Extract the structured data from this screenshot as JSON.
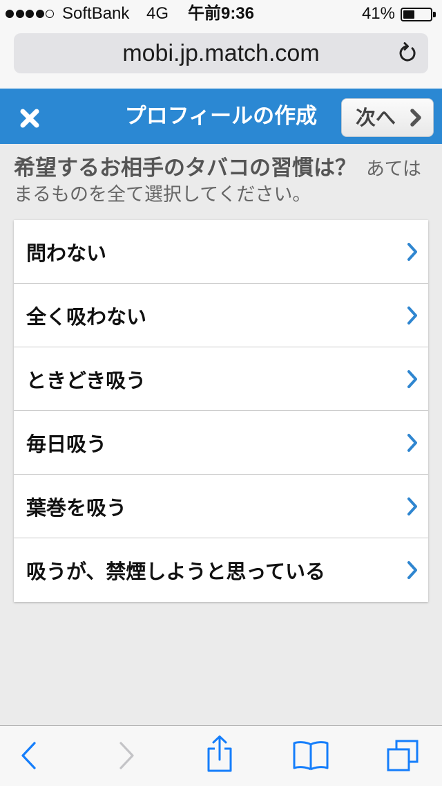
{
  "status_bar": {
    "signal": {
      "bars": 4,
      "max": 5
    },
    "carrier": "SoftBank",
    "network": "4G",
    "time": "午前9:36",
    "battery_text": "41%",
    "battery_level": 0.41
  },
  "address_bar": {
    "url": "mobi.jp.match.com",
    "reload_icon": "reload-icon"
  },
  "header": {
    "close_icon": "close-icon",
    "title": "プロフィールの作成",
    "next_label": "次へ",
    "next_icon": "chevron-right-icon"
  },
  "question": {
    "title": "希望するお相手のタバコの習慣は？",
    "hint": "あてはまるものを全て選択してください。"
  },
  "options": [
    {
      "label": "問わない",
      "icon": "chevron-right-icon"
    },
    {
      "label": "全く吸わない",
      "icon": "chevron-right-icon"
    },
    {
      "label": "ときどき吸う",
      "icon": "chevron-right-icon"
    },
    {
      "label": "毎日吸う",
      "icon": "chevron-right-icon"
    },
    {
      "label": "葉巻を吸う",
      "icon": "chevron-right-icon"
    },
    {
      "label": "吸うが、禁煙しようと思っている",
      "icon": "chevron-right-icon"
    }
  ],
  "toolbar": {
    "back_icon": "chevron-left-icon",
    "forward_icon": "chevron-right-icon",
    "forward_enabled": false,
    "share_icon": "share-icon",
    "bookmarks_icon": "bookmarks-icon",
    "tabs_icon": "tabs-icon"
  },
  "colors": {
    "header_bg": "#2b88d3",
    "header_text": "#ffffff",
    "accent": "#157efb",
    "list_chevron": "#2f86d0",
    "disabled": "#c4c4c7"
  }
}
